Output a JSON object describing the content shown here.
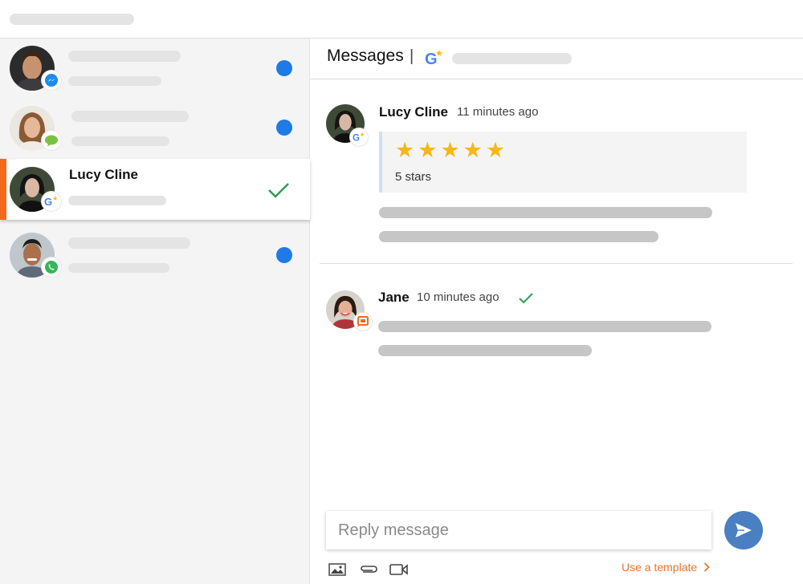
{
  "header": {
    "title": "Messages",
    "separator": "|",
    "channel_icon": "google-review-icon"
  },
  "conversations": [
    {
      "name": "",
      "channel_icon": "messenger-icon",
      "status": "unread",
      "unread_color": "#1e7ae6"
    },
    {
      "name": "",
      "channel_icon": "sms-chat-icon",
      "status": "unread",
      "unread_color": "#1e7ae6"
    },
    {
      "name": "Lucy Cline",
      "channel_icon": "google-review-icon",
      "status": "resolved",
      "active": true
    },
    {
      "name": "",
      "channel_icon": "whatsapp-icon",
      "status": "unread",
      "unread_color": "#1e7ae6"
    }
  ],
  "messages": [
    {
      "author": "Lucy Cline",
      "time": "11 minutes ago",
      "channel_icon": "google-review-icon",
      "review": {
        "stars_glyphs": "★★★★★",
        "rating": 5,
        "label": "5 stars"
      }
    },
    {
      "author": "Jane",
      "time": "10 minutes ago",
      "channel_icon": "webchat-icon",
      "status": "sent"
    }
  ],
  "reply": {
    "placeholder": "Reply message",
    "value": ""
  },
  "toolbar": {
    "template_label": "Use a template",
    "icons": [
      "image-icon",
      "attachment-icon",
      "video-icon"
    ]
  },
  "colors": {
    "accent": "#f26b1d",
    "link": "#e8752a",
    "send_button": "#4a7fc1",
    "unread_dot": "#1e7ae6",
    "star": "#f6b816",
    "check": "#2e9e4f"
  }
}
